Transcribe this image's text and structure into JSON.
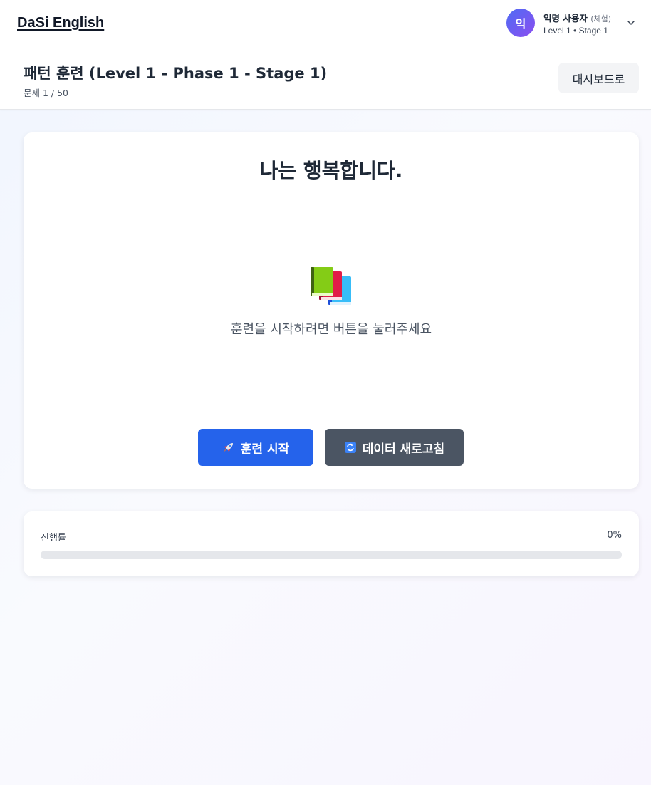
{
  "app": {
    "brand": "DaSi English"
  },
  "user": {
    "avatar_initial": "익",
    "name": "익명 사용자",
    "tag": "(체험)",
    "level_text": "Level 1 • Stage 1"
  },
  "header": {
    "title": "패턴 훈련 (Level 1 - Phase 1 - Stage 1)",
    "subtitle": "문제 1 / 50",
    "dashboard_button": "대시보드로"
  },
  "training": {
    "sentence": "나는 행복합니다.",
    "icon": "books-icon",
    "hint": "훈련을 시작하려면 버튼을 눌러주세요",
    "start_button": "훈련 시작",
    "start_icon": "rocket-icon",
    "refresh_button": "데이터 새로고침",
    "refresh_icon": "refresh-icon"
  },
  "progress": {
    "label": "진행률",
    "value_text": "0%",
    "value": 0
  },
  "colors": {
    "primary": "#2563eb",
    "secondary_button": "#4b5563",
    "avatar_gradient_start": "#4f6cf4",
    "avatar_gradient_end": "#8b4ef0"
  }
}
